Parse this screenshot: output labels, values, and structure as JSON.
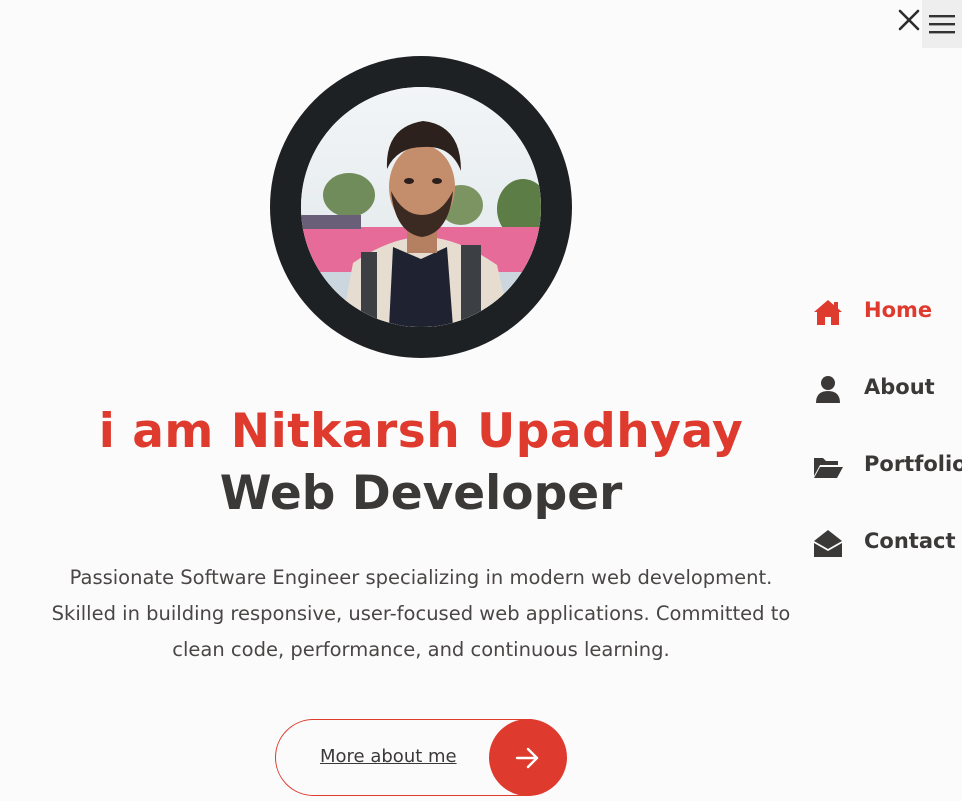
{
  "header": {
    "close_icon": "close-icon",
    "menu_icon": "hamburger-menu-icon"
  },
  "hero": {
    "name_line": "i am Nitkarsh Upadhyay",
    "role_line": "Web Developer",
    "description_lines": [
      "Passionate Software Engineer specializing in modern web development.",
      "Skilled in building responsive, user-focused web applications. Committed to",
      "clean code, performance, and continuous learning."
    ],
    "cta_label": "More about me",
    "cta_icon": "arrow-right-icon"
  },
  "nav": {
    "items": [
      {
        "label": "Home",
        "icon": "home-icon",
        "active": true
      },
      {
        "label": "About",
        "icon": "user-icon",
        "active": false
      },
      {
        "label": "Portfolio",
        "icon": "folder-open-icon",
        "active": false
      },
      {
        "label": "Contact",
        "icon": "envelope-open-icon",
        "active": false
      }
    ]
  },
  "colors": {
    "accent": "#de3a2d",
    "text_dark": "#3b3838",
    "avatar_ring": "#1e2124",
    "background": "#fcfbfb"
  }
}
